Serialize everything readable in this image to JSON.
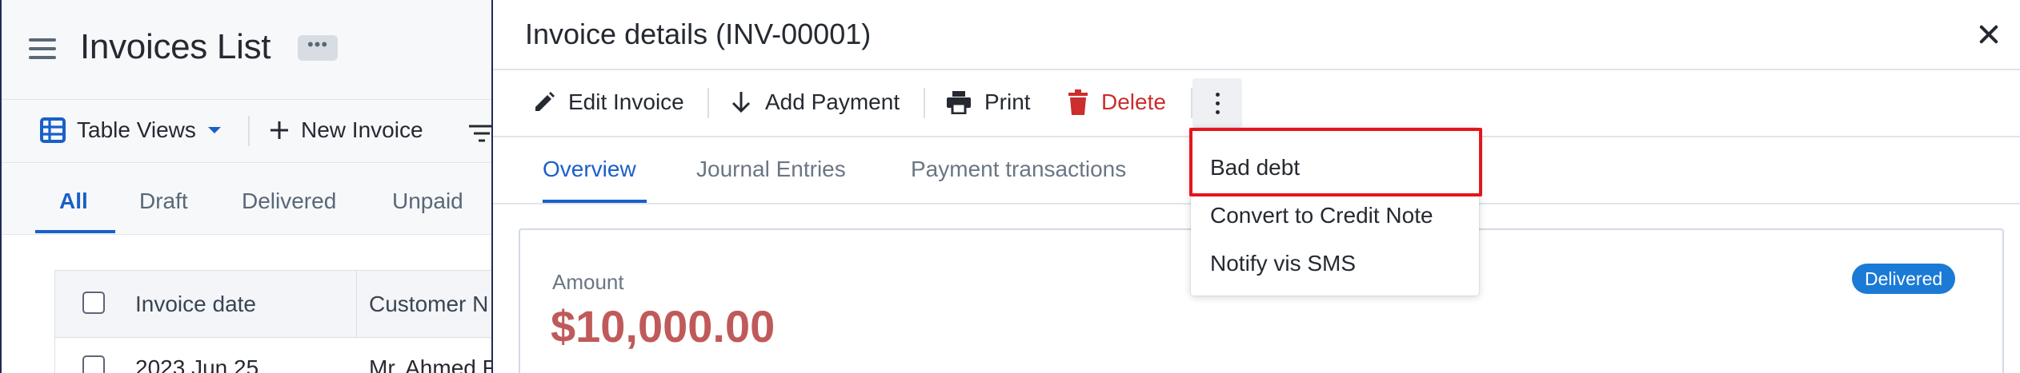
{
  "background": {
    "title": "Invoices List",
    "more_label": "•••",
    "toolbar": {
      "table_views": "Table Views",
      "new_invoice": "New Invoice"
    },
    "tabs": [
      "All",
      "Draft",
      "Delivered",
      "Unpaid"
    ],
    "active_tab": "All",
    "table": {
      "headers": [
        "Invoice date",
        "Customer N"
      ],
      "first_row": [
        "2023 Jun 25",
        "Mr. Ahmed R"
      ]
    }
  },
  "drawer": {
    "title": "Invoice details (INV-00001)",
    "toolbar": {
      "edit": "Edit Invoice",
      "add_payment": "Add Payment",
      "print": "Print",
      "delete": "Delete"
    },
    "tabs": [
      "Overview",
      "Journal Entries",
      "Payment transactions"
    ],
    "active_tab": "Overview",
    "amount_label": "Amount",
    "amount_value": "$10,000.00",
    "status": "Delivered"
  },
  "menu": {
    "items": [
      "Bad debt",
      "Convert to Credit Note",
      "Notify vis SMS"
    ],
    "highlighted": "Bad debt"
  },
  "colors": {
    "accent": "#1a5fc9",
    "danger": "#cc2d2d",
    "amount": "#c05a5a",
    "badge": "#1a7ad6",
    "highlight": "#e4161b"
  }
}
